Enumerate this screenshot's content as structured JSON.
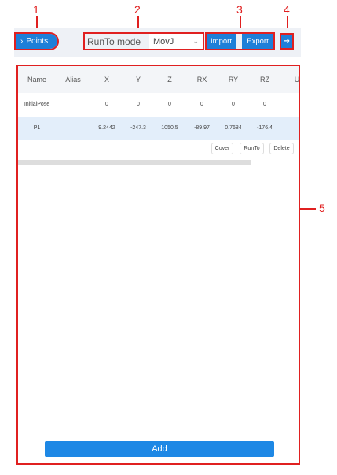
{
  "annotations": [
    "1",
    "2",
    "3",
    "4",
    "5"
  ],
  "toolbar": {
    "points_label": "Points",
    "runto_label": "RunTo mode",
    "runto_value": "MovJ",
    "import_label": "Import",
    "export_label": "Export"
  },
  "table": {
    "columns": [
      "Name",
      "Alias",
      "X",
      "Y",
      "Z",
      "RX",
      "RY",
      "RZ",
      "U"
    ],
    "rows": [
      [
        "InitialPose",
        "",
        "0",
        "0",
        "0",
        "0",
        "0",
        "0"
      ],
      [
        "P1",
        "",
        "9.2442",
        "-247.3",
        "1050.5",
        "-89.97",
        "0.7684",
        "-176.4"
      ]
    ],
    "row_actions": [
      "Cover",
      "RunTo",
      "Delete"
    ]
  },
  "add_label": "Add",
  "colors": {
    "accent": "#1e7fd8",
    "selected_row": "#e3eefa",
    "annotation": "#e02020"
  }
}
